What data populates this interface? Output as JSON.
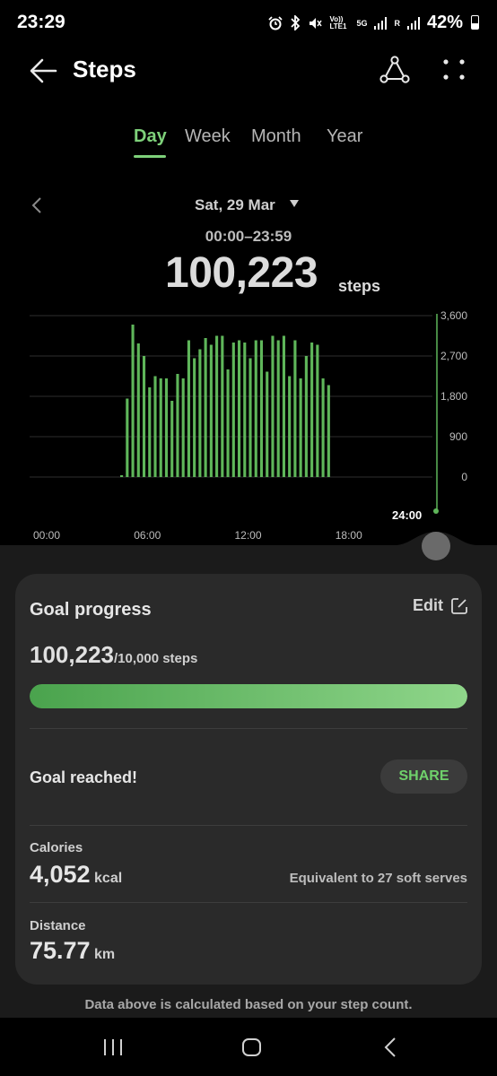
{
  "status_bar": {
    "time": "23:29",
    "icons": [
      "alarm-icon",
      "bluetooth-icon",
      "mute-icon",
      "volte-icon",
      "5g-icon",
      "signal-icon",
      "signal-icon"
    ],
    "volte_label": "Vo)) LTE1",
    "network_label": "5G",
    "roaming_label": "R",
    "battery": "42%"
  },
  "app_bar": {
    "title": "Steps"
  },
  "tabs": [
    {
      "label": "Day",
      "active": true
    },
    {
      "label": "Week",
      "active": false
    },
    {
      "label": "Month",
      "active": false
    },
    {
      "label": "Year",
      "active": false
    }
  ],
  "date": {
    "label": "Sat, 29 Mar",
    "range": "00:00–23:59"
  },
  "summary": {
    "steps": "100,223",
    "unit": "steps"
  },
  "chart_data": {
    "type": "bar",
    "y_ticks": [
      "3,600",
      "2,700",
      "1,800",
      "900",
      "0"
    ],
    "x_ticks": [
      "00:00",
      "06:00",
      "12:00",
      "18:00"
    ],
    "current_marker": "24:00",
    "ylim": [
      0,
      3600
    ],
    "bar_color": "#5fb65a",
    "interval_minutes": 20,
    "values": [
      0,
      0,
      0,
      0,
      0,
      0,
      0,
      0,
      0,
      0,
      0,
      0,
      0,
      0,
      0,
      0,
      40,
      1750,
      3400,
      2980,
      2700,
      2000,
      2250,
      2200,
      2200,
      1700,
      2300,
      2200,
      3050,
      2650,
      2850,
      3100,
      2950,
      3150,
      3150,
      2400,
      3000,
      3050,
      3000,
      2650,
      3050,
      3050,
      2350,
      3150,
      3050,
      3150,
      2250,
      3050,
      2200,
      2700,
      3000,
      2950,
      2200,
      2050,
      0,
      0,
      0,
      0,
      0,
      0,
      0,
      0,
      0,
      0,
      0,
      0,
      0,
      0,
      0,
      0,
      0,
      0
    ]
  },
  "goal": {
    "title": "Goal progress",
    "edit_label": "Edit",
    "current": "100,223",
    "target": "/10,000 steps",
    "progress": 1.0,
    "reached_label": "Goal reached!",
    "share_label": "SHARE"
  },
  "calories": {
    "label": "Calories",
    "value": "4,052",
    "unit": "kcal",
    "equivalent": "Equivalent to 27 soft serves"
  },
  "distance": {
    "label": "Distance",
    "value": "75.77",
    "unit": "km"
  },
  "footnote": "Data above is calculated based on your step count."
}
